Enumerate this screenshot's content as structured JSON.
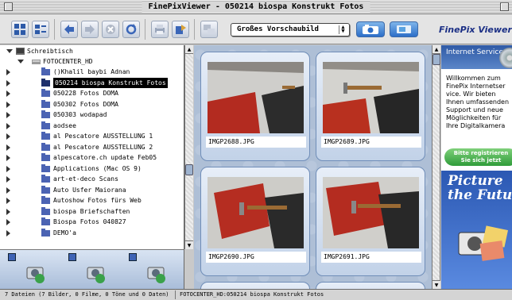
{
  "window": {
    "title": "FinePixViewer - 050214 biospa Konstrukt Fotos"
  },
  "toolbar": {
    "view_mode": "Großes Vorschaubild",
    "brand": "FinePix Viewer"
  },
  "tree": {
    "root": "Schreibtisch",
    "volume": "FOTOCENTER_HD",
    "items": [
      {
        "label": "()Khalil baybi Adnan",
        "selected": false
      },
      {
        "label": "050214 biospa Konstrukt Fotos",
        "selected": true
      },
      {
        "label": "050228 Fotos DOMA",
        "selected": false
      },
      {
        "label": "050302 Fotos DOMA",
        "selected": false
      },
      {
        "label": "050303 wodapad",
        "selected": false
      },
      {
        "label": "aodsee",
        "selected": false
      },
      {
        "label": "al Pescatore AUSSTELLUNG 1",
        "selected": false
      },
      {
        "label": "al Pescatore AUSSTELLUNG 2",
        "selected": false
      },
      {
        "label": "alpescatore.ch update Feb05",
        "selected": false
      },
      {
        "label": "Applications (Mac OS 9)",
        "selected": false
      },
      {
        "label": "art-et-deco Scans",
        "selected": false
      },
      {
        "label": "Auto Usfer Maiorana",
        "selected": false
      },
      {
        "label": "Autoshow Fotos fürs Web",
        "selected": false
      },
      {
        "label": "biospa Briefschaften",
        "selected": false
      },
      {
        "label": "Biospa Fotos 040827",
        "selected": false
      },
      {
        "label": "DEMO'a",
        "selected": false
      }
    ]
  },
  "thumbnails": [
    {
      "filename": "IMGP2688.JPG"
    },
    {
      "filename": "IMGP2689.JPG"
    },
    {
      "filename": "IMGP2690.JPG"
    },
    {
      "filename": "IMGP2691.JPG"
    }
  ],
  "side_panel": {
    "banner_text": "Internet Service",
    "welcome_text": "Willkommen zum\nFinePix Internetser\nvice. Wir bieten\nIhnen umfassenden\nSupport und neue\nMöglichkeiten für\nIhre Digitalkamera",
    "register_button": "Bitte registrieren\nSie sich jetzt",
    "promo_text": "Picture\nthe Future"
  },
  "statusbar": {
    "summary": "7 Dateien (7 Bilder, 0 Filme, 0 Töne und 0 Daten)",
    "path": "FOTOCENTER_HD:050214 biospa Konstrukt Fotos"
  },
  "colors": {
    "selection": "#000000",
    "thumb_background": "#aebfd6",
    "brand_blue": "#1b2f85"
  }
}
